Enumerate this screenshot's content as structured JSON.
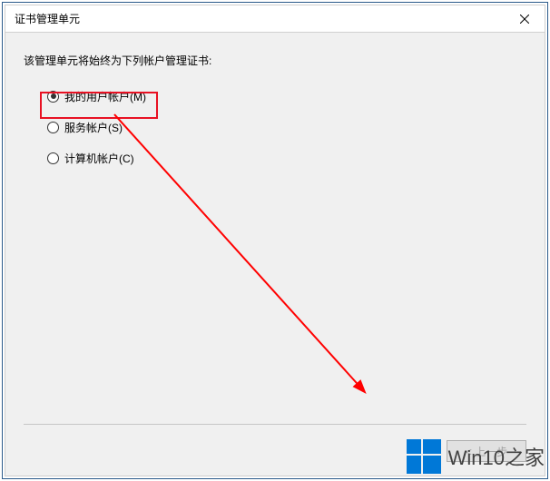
{
  "window": {
    "title": "证书管理单元"
  },
  "content": {
    "prompt": "该管理单元将始终为下列帐户管理证书:",
    "options": [
      {
        "label": "我的用户帐户(M)",
        "checked": true
      },
      {
        "label": "服务帐户(S)",
        "checked": false
      },
      {
        "label": "计算机帐户(C)",
        "checked": false
      }
    ]
  },
  "buttons": {
    "back": "< 上一步"
  },
  "watermark": {
    "text": "Win10之家"
  },
  "annotation": {
    "highlight_color": "#e81123",
    "arrow_color": "#ff0000"
  }
}
